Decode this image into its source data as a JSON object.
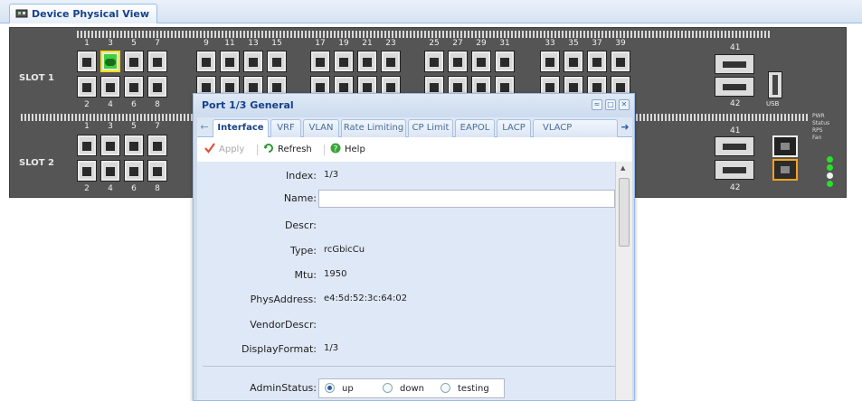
{
  "tab": {
    "label": "Device Physical View"
  },
  "chassis": {
    "slots": [
      "SLOT 1",
      "SLOT 2"
    ],
    "top_numbers": [
      "1",
      "3",
      "5",
      "7",
      "9",
      "11",
      "13",
      "15",
      "17",
      "19",
      "21",
      "23",
      "25",
      "27",
      "29",
      "31",
      "33",
      "35",
      "37",
      "39"
    ],
    "bottom_numbers_slot1": [
      "2",
      "4",
      "6",
      "8"
    ],
    "bottom_numbers_slot2": [
      "2",
      "4",
      "6",
      "8"
    ],
    "sfp_numbers": [
      "41",
      "42"
    ],
    "usb_label": "USB",
    "legend": [
      "PWR",
      "Status",
      "RPS",
      "Fan"
    ],
    "active_port": "1/3"
  },
  "dialog": {
    "title": "Port 1/3 General",
    "tabs": [
      "Interface",
      "VRF",
      "VLAN",
      "Rate Limiting",
      "CP Limit",
      "EAPOL",
      "LACP",
      "VLACP"
    ],
    "selected_tab": "Interface",
    "toolbar": {
      "apply": "Apply",
      "refresh": "Refresh",
      "help": "Help"
    },
    "fields": {
      "index_label": "Index:",
      "index_value": "1/3",
      "name_label": "Name:",
      "name_value": "",
      "descr_label": "Descr:",
      "descr_value": "",
      "type_label": "Type:",
      "type_value": "rcGbicCu",
      "mtu_label": "Mtu:",
      "mtu_value": "1950",
      "phys_label": "PhysAddress:",
      "phys_value": "e4:5d:52:3c:64:02",
      "vendor_label": "VendorDescr:",
      "vendor_value": "",
      "display_label": "DisplayFormat:",
      "display_value": "1/3",
      "admin_label": "AdminStatus:",
      "admin_options": [
        "up",
        "down",
        "testing"
      ],
      "admin_selected": "up"
    }
  },
  "colors": {
    "chassis": "#555555",
    "active_port": "#3fcf3f",
    "accent": "#15428b",
    "orange_port": "#f7a21a"
  }
}
